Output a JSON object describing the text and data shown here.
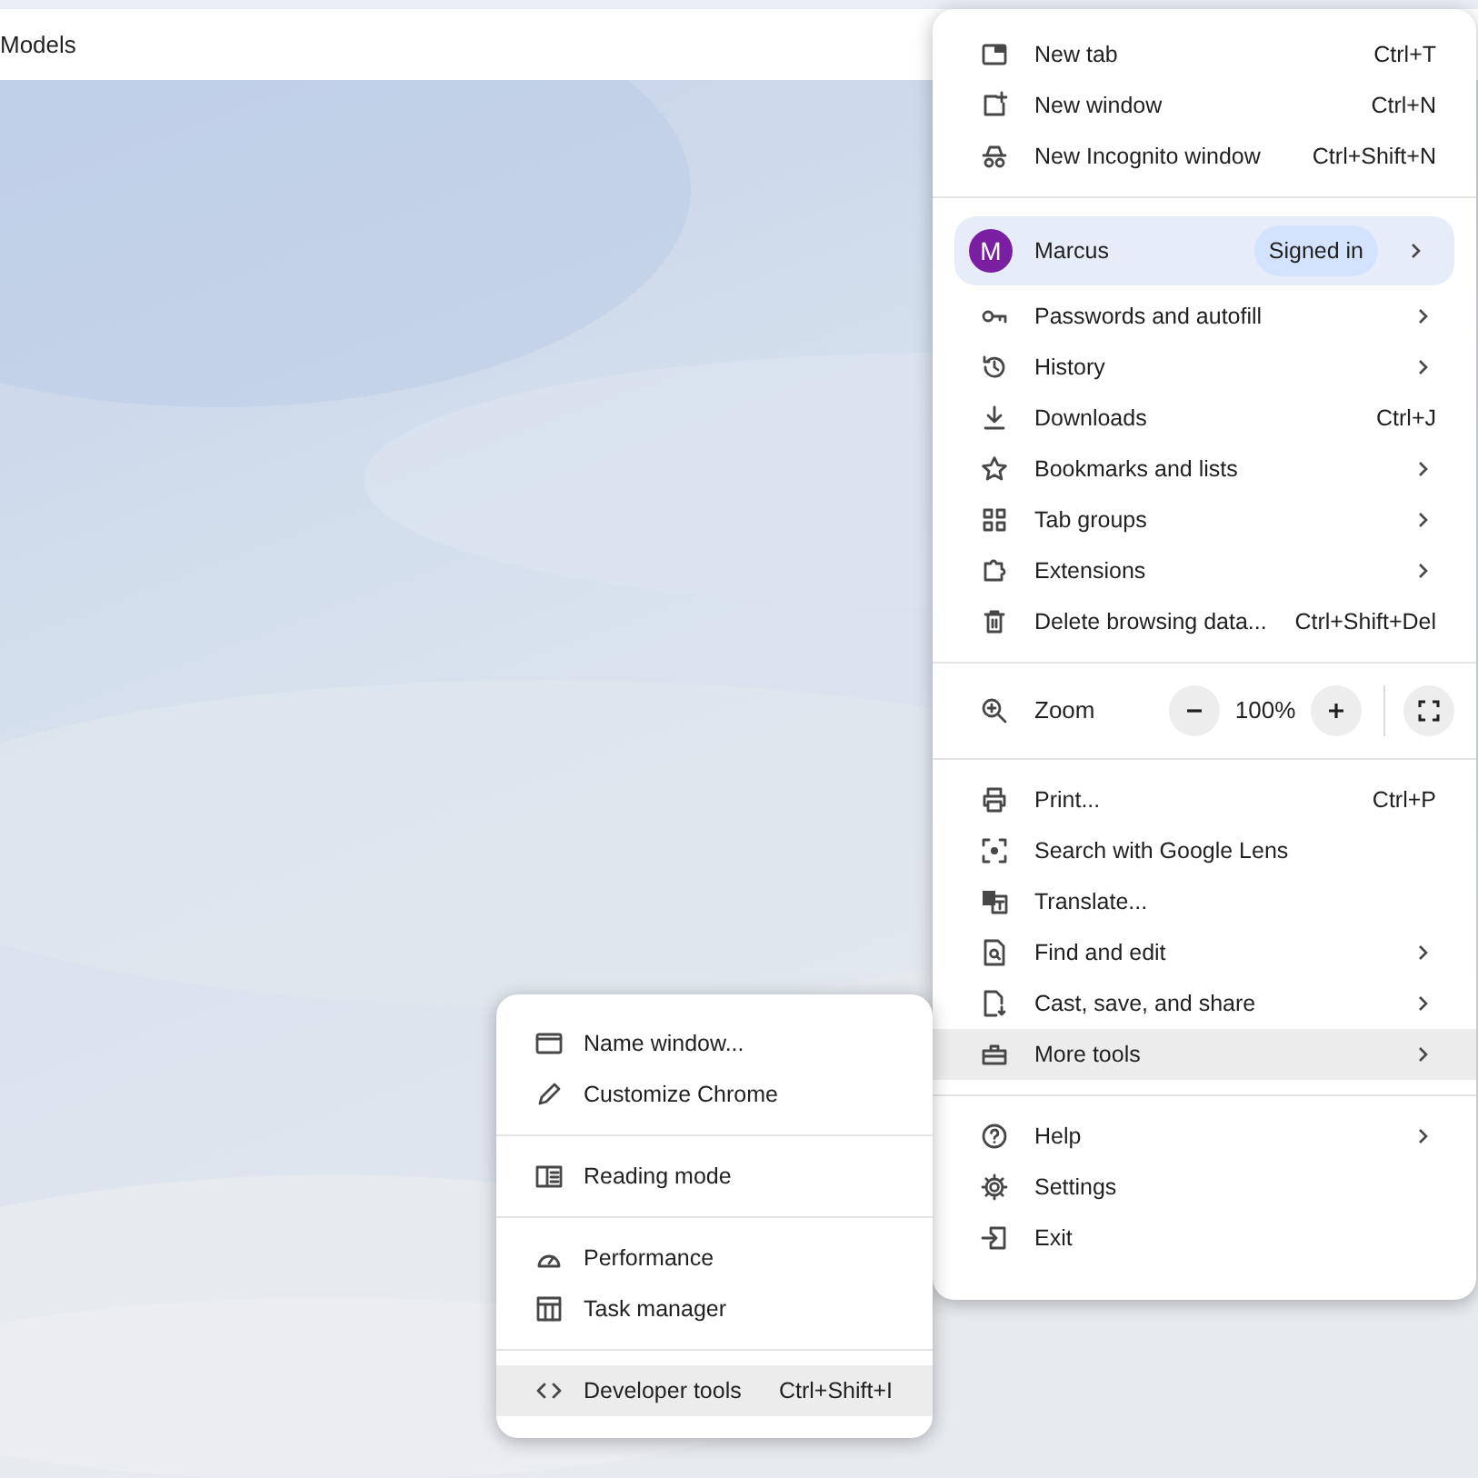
{
  "page_tab": {
    "title": "Models"
  },
  "main_menu": {
    "groups": [
      {
        "items": [
          {
            "kind": "command",
            "label": "New tab",
            "shortcut": "Ctrl+T",
            "has_submenu": false,
            "highlighted": false
          },
          {
            "kind": "command",
            "label": "New window",
            "shortcut": "Ctrl+N",
            "has_submenu": false,
            "highlighted": false
          },
          {
            "kind": "command",
            "label": "New Incognito window",
            "shortcut": "Ctrl+Shift+N",
            "has_submenu": false,
            "highlighted": false
          }
        ]
      },
      {
        "items": [
          {
            "kind": "profile",
            "avatar": "M",
            "label": "Marcus",
            "status": "Signed in",
            "has_submenu": true,
            "highlighted": false
          },
          {
            "kind": "command",
            "label": "Passwords and autofill",
            "has_submenu": true,
            "highlighted": false
          },
          {
            "kind": "command",
            "label": "History",
            "has_submenu": true,
            "highlighted": false
          },
          {
            "kind": "command",
            "label": "Downloads",
            "shortcut": "Ctrl+J",
            "has_submenu": false,
            "highlighted": false
          },
          {
            "kind": "command",
            "label": "Bookmarks and lists",
            "has_submenu": true,
            "highlighted": false
          },
          {
            "kind": "command",
            "label": "Tab groups",
            "has_submenu": true,
            "highlighted": false
          },
          {
            "kind": "command",
            "label": "Extensions",
            "has_submenu": true,
            "highlighted": false
          },
          {
            "kind": "command",
            "label": "Delete browsing data...",
            "shortcut": "Ctrl+Shift+Del",
            "has_submenu": false,
            "highlighted": false
          }
        ]
      },
      {
        "items": [
          {
            "kind": "zoom",
            "label": "Zoom",
            "value": "100%"
          }
        ]
      },
      {
        "items": [
          {
            "kind": "command",
            "label": "Print...",
            "shortcut": "Ctrl+P",
            "has_submenu": false,
            "highlighted": false
          },
          {
            "kind": "command",
            "label": "Search with Google Lens",
            "has_submenu": false,
            "highlighted": false
          },
          {
            "kind": "command",
            "label": "Translate...",
            "has_submenu": false,
            "highlighted": false
          },
          {
            "kind": "command",
            "label": "Find and edit",
            "has_submenu": true,
            "highlighted": false
          },
          {
            "kind": "command",
            "label": "Cast, save, and share",
            "has_submenu": true,
            "highlighted": false
          },
          {
            "kind": "command",
            "label": "More tools",
            "has_submenu": true,
            "highlighted": true
          }
        ]
      },
      {
        "items": [
          {
            "kind": "command",
            "label": "Help",
            "has_submenu": true,
            "highlighted": false
          },
          {
            "kind": "command",
            "label": "Settings",
            "has_submenu": false,
            "highlighted": false
          },
          {
            "kind": "command",
            "label": "Exit",
            "has_submenu": false,
            "highlighted": false
          }
        ]
      }
    ]
  },
  "more_tools_menu": {
    "groups": [
      {
        "items": [
          {
            "kind": "command",
            "label": "Name window...",
            "has_submenu": false,
            "highlighted": false
          },
          {
            "kind": "command",
            "label": "Customize Chrome",
            "has_submenu": false,
            "highlighted": false
          }
        ]
      },
      {
        "items": [
          {
            "kind": "command",
            "label": "Reading mode",
            "has_submenu": false,
            "highlighted": false
          }
        ]
      },
      {
        "items": [
          {
            "kind": "command",
            "label": "Performance",
            "has_submenu": false,
            "highlighted": false
          },
          {
            "kind": "command",
            "label": "Task manager",
            "has_submenu": false,
            "highlighted": false
          }
        ]
      },
      {
        "items": [
          {
            "kind": "command",
            "label": "Developer tools",
            "shortcut": "Ctrl+Shift+I",
            "has_submenu": false,
            "highlighted": true
          }
        ]
      }
    ]
  }
}
